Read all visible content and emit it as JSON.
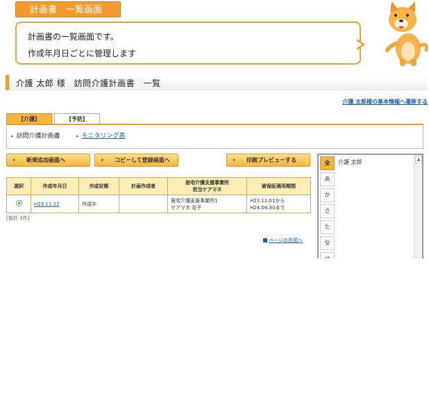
{
  "header": {
    "badge": "計画書　一覧画面",
    "bubble_line1": "計画書の一覧画面です。",
    "bubble_line2": "作成年月日ごとに管理します"
  },
  "page": {
    "heading": "介護 太郎 様　訪問介護計画書　一覧",
    "basic_info_link": "介護 太郎様の基本情報へ遷移する"
  },
  "tabs": [
    {
      "label": "【介護】",
      "active": true
    },
    {
      "label": "【予防】",
      "active": false
    }
  ],
  "subnav": {
    "item1": "訪問介護計画書",
    "item2": "モニタリング表"
  },
  "buttons": {
    "new": "新規追加画面へ",
    "copy": "コピーして登録画面へ",
    "print": "印刷プレビューする"
  },
  "table": {
    "headers": [
      "選択",
      "作成年月日",
      "作成状態",
      "計画作成者",
      "居宅介護支援事業所",
      "担当ケアマネ",
      "被保証適用期間"
    ],
    "rows": [
      {
        "date": "H23.11.22",
        "status": "作成中",
        "author": "",
        "office": "居宅介護支援事業所1",
        "caremanager": "ケアマネ 花子",
        "period_from": "H23.11.01から",
        "period_to": "H24.04.30まで"
      }
    ],
    "total": "[合計:1件]",
    "to_top": "ページの先頭へ"
  },
  "kana": {
    "buttons": [
      "全",
      "あ",
      "か",
      "さ",
      "た",
      "な",
      "は"
    ],
    "names": [
      "介護 太郎"
    ]
  },
  "colors": {
    "accent": "#f29a2e",
    "link": "#1a5fb4",
    "header_bg": "#fbedb3"
  }
}
